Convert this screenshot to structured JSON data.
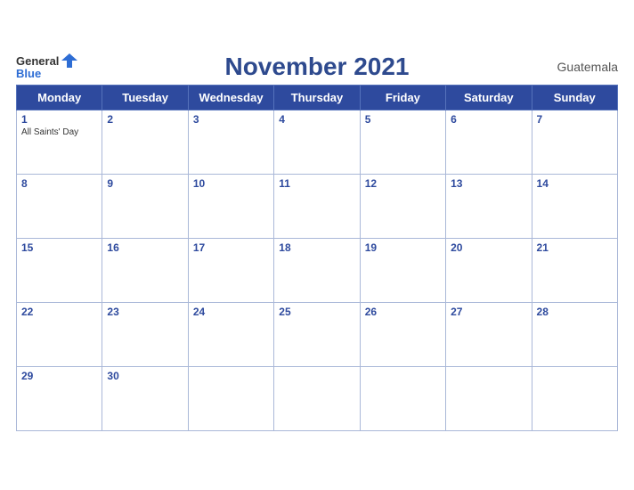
{
  "header": {
    "logo_general": "General",
    "logo_blue": "Blue",
    "title": "November 2021",
    "country": "Guatemala"
  },
  "weekdays": [
    "Monday",
    "Tuesday",
    "Wednesday",
    "Thursday",
    "Friday",
    "Saturday",
    "Sunday"
  ],
  "weeks": [
    [
      {
        "day": "1",
        "holiday": "All Saints' Day"
      },
      {
        "day": "2",
        "holiday": ""
      },
      {
        "day": "3",
        "holiday": ""
      },
      {
        "day": "4",
        "holiday": ""
      },
      {
        "day": "5",
        "holiday": ""
      },
      {
        "day": "6",
        "holiday": ""
      },
      {
        "day": "7",
        "holiday": ""
      }
    ],
    [
      {
        "day": "8",
        "holiday": ""
      },
      {
        "day": "9",
        "holiday": ""
      },
      {
        "day": "10",
        "holiday": ""
      },
      {
        "day": "11",
        "holiday": ""
      },
      {
        "day": "12",
        "holiday": ""
      },
      {
        "day": "13",
        "holiday": ""
      },
      {
        "day": "14",
        "holiday": ""
      }
    ],
    [
      {
        "day": "15",
        "holiday": ""
      },
      {
        "day": "16",
        "holiday": ""
      },
      {
        "day": "17",
        "holiday": ""
      },
      {
        "day": "18",
        "holiday": ""
      },
      {
        "day": "19",
        "holiday": ""
      },
      {
        "day": "20",
        "holiday": ""
      },
      {
        "day": "21",
        "holiday": ""
      }
    ],
    [
      {
        "day": "22",
        "holiday": ""
      },
      {
        "day": "23",
        "holiday": ""
      },
      {
        "day": "24",
        "holiday": ""
      },
      {
        "day": "25",
        "holiday": ""
      },
      {
        "day": "26",
        "holiday": ""
      },
      {
        "day": "27",
        "holiday": ""
      },
      {
        "day": "28",
        "holiday": ""
      }
    ],
    [
      {
        "day": "29",
        "holiday": ""
      },
      {
        "day": "30",
        "holiday": ""
      },
      {
        "day": "",
        "holiday": ""
      },
      {
        "day": "",
        "holiday": ""
      },
      {
        "day": "",
        "holiday": ""
      },
      {
        "day": "",
        "holiday": ""
      },
      {
        "day": "",
        "holiday": ""
      }
    ]
  ]
}
